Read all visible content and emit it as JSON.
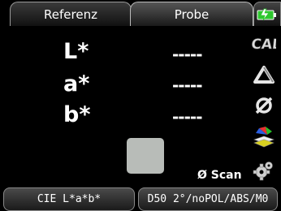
{
  "tabs": [
    {
      "label": "Referenz",
      "active": false
    },
    {
      "label": "Probe",
      "active": true
    }
  ],
  "battery_icon": "battery-charging-icon",
  "measurements": [
    {
      "label": "L*",
      "value": "-----"
    },
    {
      "label": "a*",
      "value": "-----"
    },
    {
      "label": "b*",
      "value": "-----"
    }
  ],
  "side_icons": [
    {
      "name": "cal-icon",
      "text": "CAL"
    },
    {
      "name": "delta-icon"
    },
    {
      "name": "null-icon"
    },
    {
      "name": "color-palette-icon"
    },
    {
      "name": "settings-gear-icon"
    }
  ],
  "swatch_color": "#b8bcb8",
  "scan_label": "Ø Scan",
  "footer": {
    "color_space": "CIE L*a*b*",
    "conditions": "D50 2°/noPOL/ABS/M0"
  },
  "colors": {
    "accent_green": "#2ec72e",
    "background": "#000000"
  }
}
